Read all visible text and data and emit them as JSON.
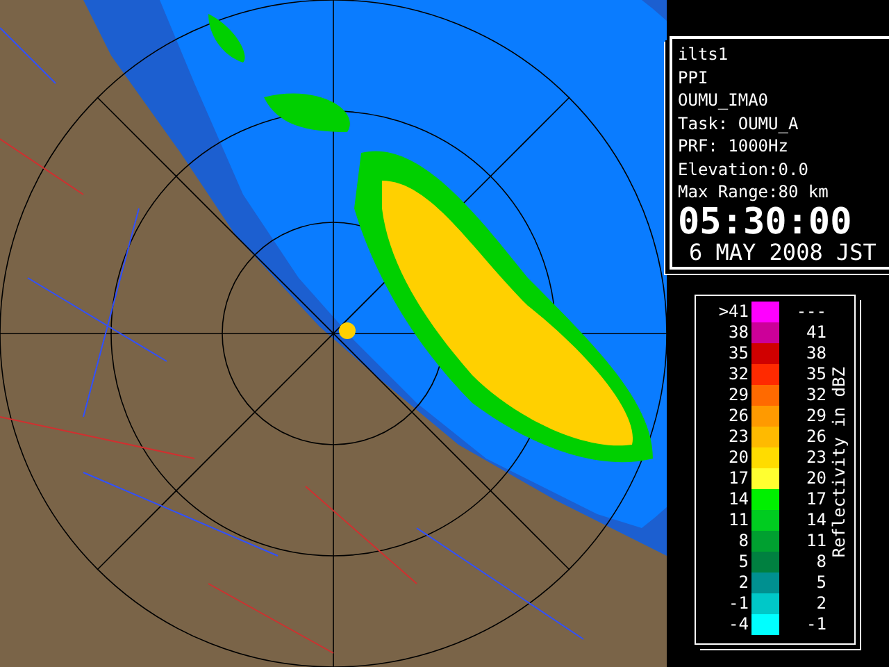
{
  "info": {
    "lines": [
      "ilts1",
      "PPI",
      "OUMU_IMA0",
      "Task: OUMU_A",
      "PRF: 1000Hz",
      "Elevation:0.0",
      "Max Range:80 km"
    ],
    "time": "05:30:00",
    "date": "6 MAY 2008 JST"
  },
  "legend": {
    "title": "Reflectivity in dBZ",
    "rows": [
      {
        "low": ">41",
        "high": "---",
        "color": "#ff00ff"
      },
      {
        "low": "38",
        "high": "41",
        "color": "#cc0099"
      },
      {
        "low": "35",
        "high": "38",
        "color": "#d00000"
      },
      {
        "low": "32",
        "high": "35",
        "color": "#ff2a00"
      },
      {
        "low": "29",
        "high": "32",
        "color": "#ff6a00"
      },
      {
        "low": "26",
        "high": "29",
        "color": "#ff9a00"
      },
      {
        "low": "23",
        "high": "26",
        "color": "#ffba00"
      },
      {
        "low": "20",
        "high": "23",
        "color": "#ffdc00"
      },
      {
        "low": "17",
        "high": "20",
        "color": "#ffff30"
      },
      {
        "low": "14",
        "high": "17",
        "color": "#00f000"
      },
      {
        "low": "11",
        "high": "14",
        "color": "#00cc20"
      },
      {
        "low": "8",
        "high": "11",
        "color": "#00a030"
      },
      {
        "low": "5",
        "high": "8",
        "color": "#008040"
      },
      {
        "low": "2",
        "high": "5",
        "color": "#009090"
      },
      {
        "low": "-1",
        "high": "2",
        "color": "#00c8c8"
      },
      {
        "low": "-4",
        "high": "-1",
        "color": "#00ffff"
      }
    ]
  }
}
